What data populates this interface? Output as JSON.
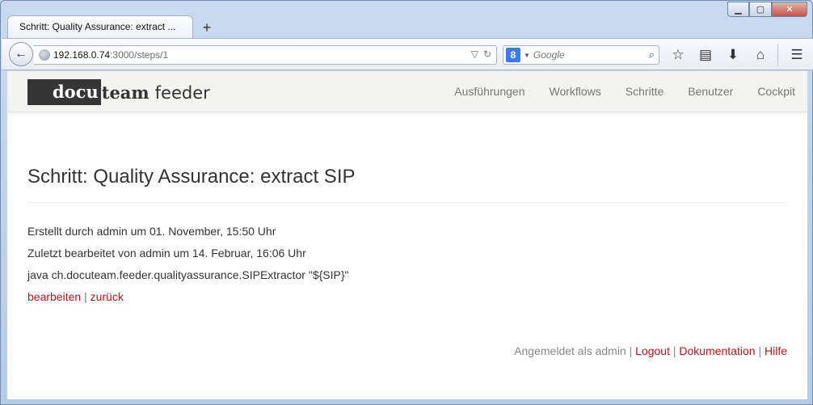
{
  "browser": {
    "tab_title": "Schritt: Quality Assurance: extract ...",
    "new_tab_label": "+",
    "url_host": "192.168.0.74",
    "url_rest": ":3000/steps/1",
    "search_placeholder": "Google",
    "search_engine_letter": "8",
    "window_controls": {
      "minimize": "▁",
      "restore": "▢",
      "close": "✕"
    }
  },
  "site": {
    "logo": {
      "part1": "docu",
      "part2": "team",
      "part3": "feeder"
    },
    "nav": [
      {
        "label": "Ausführungen"
      },
      {
        "label": "Workflows"
      },
      {
        "label": "Schritte"
      },
      {
        "label": "Benutzer"
      },
      {
        "label": "Cockpit"
      }
    ]
  },
  "step": {
    "title": "Schritt: Quality Assurance: extract SIP",
    "created": "Erstellt durch admin um 01. November, 15:50 Uhr",
    "updated": "Zuletzt bearbeitet von admin um 14. Februar, 16:06 Uhr",
    "command": "java ch.docuteam.feeder.qualityassurance.SIPExtractor \"${SIP}\"",
    "edit_label": "bearbeiten",
    "link_sep": " | ",
    "back_label": "zurück"
  },
  "footer": {
    "logged_in_text": "Angemeldet als admin",
    "sep": " | ",
    "logout_label": "Logout",
    "docs_label": "Dokumentation",
    "help_label": "Hilfe"
  },
  "colors": {
    "link_red": "#b5151b",
    "logo_box": "#353535"
  }
}
